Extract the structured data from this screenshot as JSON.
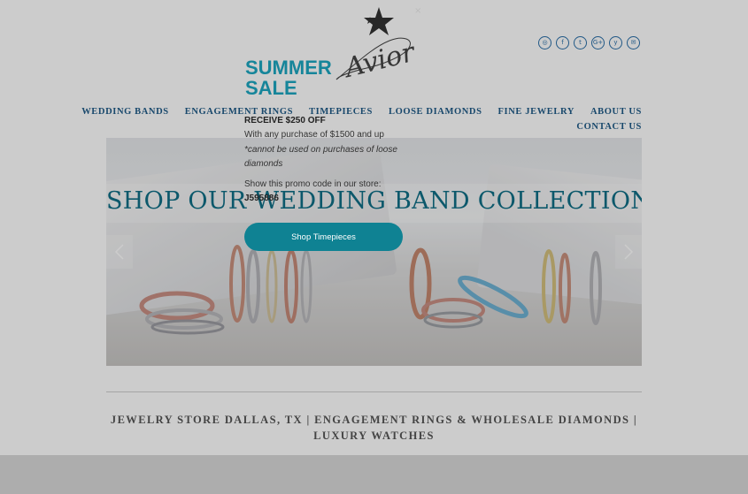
{
  "logo": {
    "text": "Avior"
  },
  "social": [
    {
      "icon": "instagram-icon",
      "glyph": "◎"
    },
    {
      "icon": "facebook-icon",
      "glyph": "f"
    },
    {
      "icon": "twitter-icon",
      "glyph": "t"
    },
    {
      "icon": "google-plus-icon",
      "glyph": "G+"
    },
    {
      "icon": "yelp-icon",
      "glyph": "y"
    },
    {
      "icon": "email-icon",
      "glyph": "✉"
    }
  ],
  "nav": {
    "wedding_bands": "WEDDING BANDS",
    "engagement_rings": "ENGAGEMENT RINGS",
    "timepieces": "TIMEPIECES",
    "loose_diamonds": "LOOSE DIAMONDS",
    "fine_jewelry": "FINE JEWELRY",
    "about_us": "ABOUT US",
    "contact_us": "CONTACT US"
  },
  "hero": {
    "title": "SHOP OUR WEDDING BAND COLLECTION"
  },
  "tagline": "JEWELRY STORE DALLAS, TX | ENGAGEMENT RINGS & WHOLESALE DIAMONDS | LUXURY WATCHES",
  "popup": {
    "close": "×",
    "title": "SUMMER SALE",
    "receive": "RECEIVE $250 OFF",
    "line": "With any purchase of $1500 and up",
    "note": " *cannot be used on purchases of loose diamonds",
    "show": "Show this promo code in our store:",
    "code": "J595886",
    "button": "Shop Timepieces"
  },
  "colors": {
    "accent": "#0f8293",
    "nav": "#1f5a87",
    "hero_title": "#0f6f86"
  }
}
